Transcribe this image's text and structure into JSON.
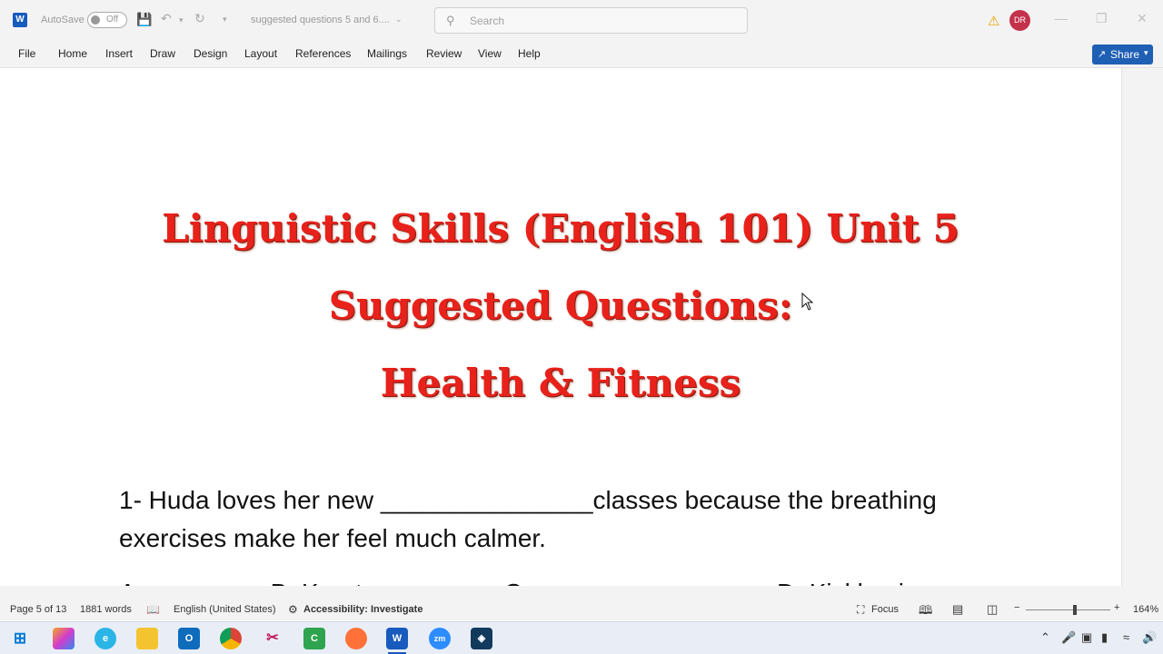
{
  "titlebar": {
    "app_icon": "word-icon",
    "autosave_label": "AutoSave",
    "autosave_state": "Off",
    "doc_name": "suggested questions 5 and 6....",
    "search_placeholder": "Search",
    "avatar_initials": "DR"
  },
  "menu": {
    "items": [
      "File",
      "Home",
      "Insert",
      "Draw",
      "Design",
      "Layout",
      "References",
      "Mailings",
      "Review",
      "View",
      "Help"
    ],
    "share_label": "Share"
  },
  "document": {
    "title_line1": "Linguistic Skills (English 101) Unit 5",
    "title_line2": "Suggested Questions:",
    "title_line3": "Health & Fitness",
    "q1_line1": "1- Huda loves her new _______________classes because the breathing",
    "q1_line2": "exercises make her feel much calmer.",
    "options_partial": "A. ________  B. Karate  ________  C. ________  ________  D. Kickboxing"
  },
  "status": {
    "page": "Page 5 of 13",
    "words": "1881 words",
    "language": "English (United States)",
    "accessibility": "Accessibility: Investigate",
    "focus": "Focus",
    "zoom": "164%"
  },
  "colors": {
    "title_red": "#e8221b",
    "share_blue": "#1f5fb4",
    "avatar_red": "#c4314b"
  }
}
